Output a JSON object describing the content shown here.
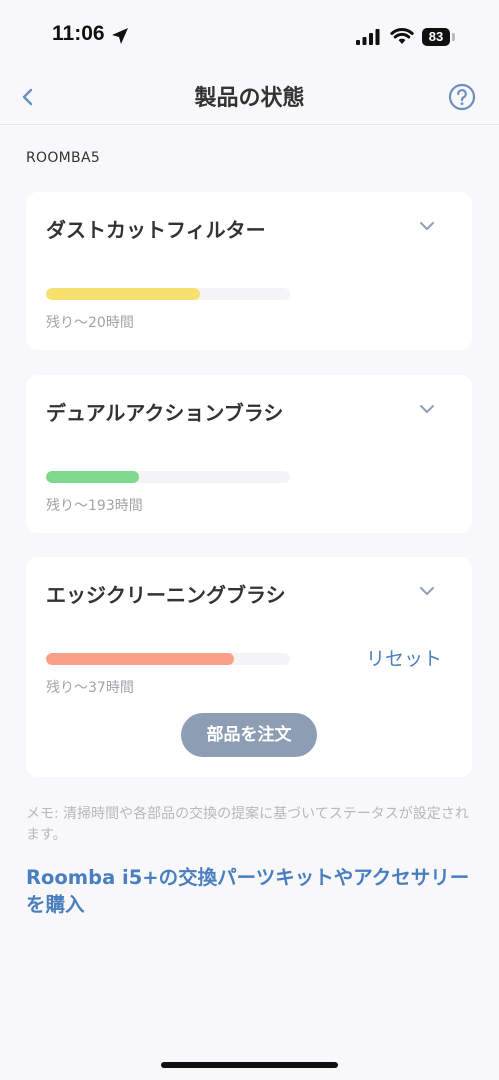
{
  "status_bar": {
    "time": "11:06",
    "battery": "83"
  },
  "nav": {
    "title": "製品の状態"
  },
  "device_name": "ROOMBA5",
  "parts": [
    {
      "name": "ダストカットフィルター",
      "remaining": "残り〜20時間",
      "level": 0.63,
      "color": "#f7e06e"
    },
    {
      "name": "デュアルアクションブラシ",
      "remaining": "残り〜193時間",
      "level": 0.38,
      "color": "#7ed98c"
    },
    {
      "name": "エッジクリーニングブラシ",
      "remaining": "残り〜37時間",
      "level": 0.77,
      "color": "#f9a187",
      "reset_label": "リセット",
      "order_label": "部品を注文"
    }
  ],
  "note": "メモ: 清掃時間や各部品の交換の提案に基づいてステータスが設定されます。",
  "parts_link": "Roomba i5+の交換パーツキットやアクセサリーを購入",
  "icons": [
    "location-arrow-icon",
    "signal-icon",
    "wifi-icon",
    "back-icon",
    "help-icon",
    "chevron-down-icon"
  ],
  "colors": {
    "accent": "#4a7fbf",
    "button": "#8d9db3"
  }
}
